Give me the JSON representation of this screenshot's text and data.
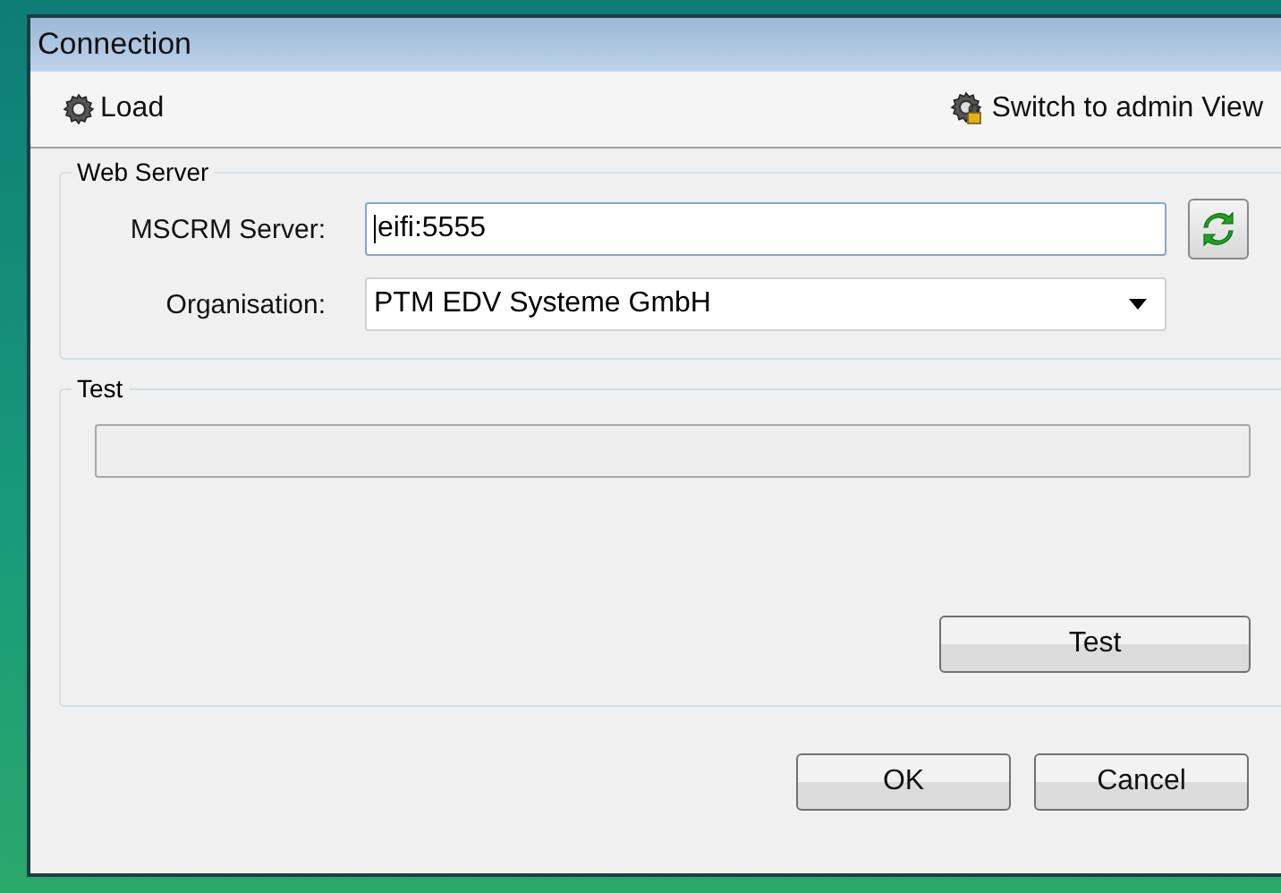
{
  "window": {
    "title": "Connection"
  },
  "toolbar": [
    {
      "kind": "load",
      "label": "Load"
    },
    {
      "kind": "admin",
      "label": "Switch to admin View"
    }
  ],
  "web_server": {
    "title": "Web Server",
    "server_label": "MSCRM Server:",
    "server_value": "eifi:5555",
    "organisation_label": "Organisation:",
    "organisation_value": "PTM EDV Systeme GmbH"
  },
  "test": {
    "title": "Test",
    "level": 0,
    "button": "Test"
  },
  "buttons": [
    "OK",
    "Cancel"
  ]
}
